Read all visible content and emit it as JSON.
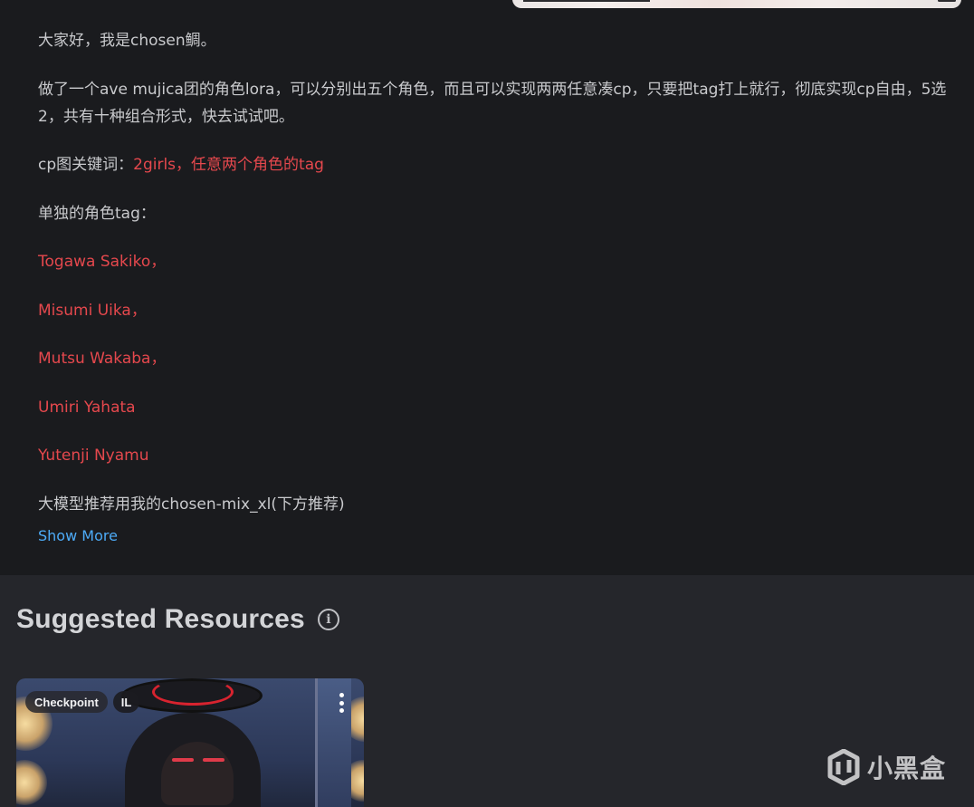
{
  "description": {
    "greeting": "大家好，我是chosen鲷。",
    "intro": "做了一个ave mujica团的角色lora，可以分别出五个角色，而且可以实现两两任意凑cp，只要把tag打上就行，彻底实现cp自由，5选2，共有十种组合形式，快去试试吧。",
    "cp_label": "cp图关键词：",
    "cp_keywords": "2girls，任意两个角色的tag",
    "single_label": "单独的角色tag：",
    "characters": [
      "Togawa Sakiko，",
      "Misumi Uika，",
      "Mutsu Wakaba，",
      "Umiri Yahata",
      "Yutenji Nyamu"
    ],
    "model_note": "大模型推荐用我的chosen-mix_xl(下方推荐)",
    "show_more": "Show More"
  },
  "suggested": {
    "title": "Suggested Resources",
    "info_icon": "info-icon",
    "card": {
      "type_badge": "Checkpoint",
      "base_badge": "IL",
      "menu_icon": "kebab-menu-icon"
    }
  },
  "watermark": {
    "text": "小黑盒",
    "icon": "xiaoheihe-logo"
  },
  "colors": {
    "background": "#1a1b1e",
    "section_background": "#25262b",
    "accent_red": "#e5484d",
    "link_blue": "#4dabf7"
  }
}
